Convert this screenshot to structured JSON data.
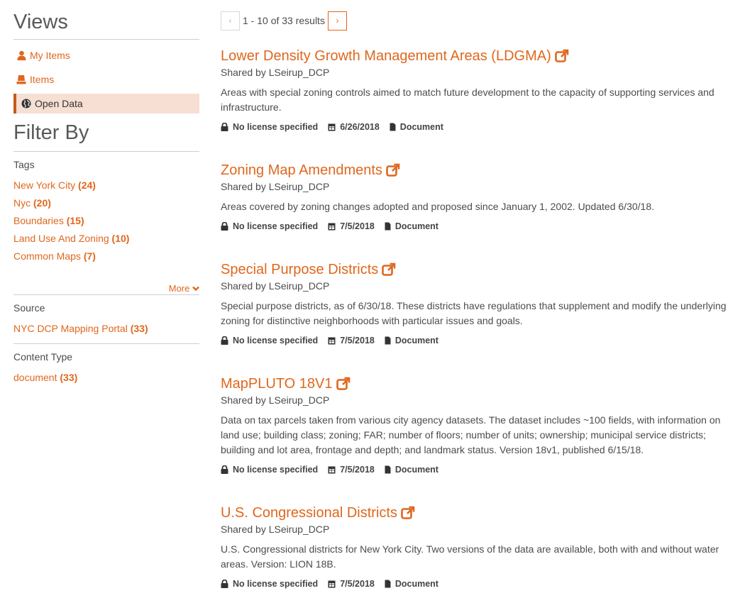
{
  "sidebar": {
    "views_title": "Views",
    "views": [
      {
        "label": "My Items",
        "icon": "user-icon"
      },
      {
        "label": "Items",
        "icon": "items-icon"
      },
      {
        "label": "Open Data",
        "icon": "globe-icon",
        "active": true
      }
    ],
    "filter_title": "Filter By",
    "tags": {
      "label": "Tags",
      "items": [
        {
          "name": "New York City",
          "count": "(24)"
        },
        {
          "name": "Nyc",
          "count": "(20)"
        },
        {
          "name": "Boundaries",
          "count": "(15)"
        },
        {
          "name": "Land Use And Zoning",
          "count": "(10)"
        },
        {
          "name": "Common Maps",
          "count": "(7)"
        }
      ],
      "more_label": "More"
    },
    "source": {
      "label": "Source",
      "items": [
        {
          "name": "NYC DCP Mapping Portal",
          "count": "(33)"
        }
      ]
    },
    "content_type": {
      "label": "Content Type",
      "items": [
        {
          "name": "document",
          "count": "(33)"
        }
      ]
    }
  },
  "pager": {
    "prev": "‹",
    "next": "›",
    "summary": "1 - 10 of 33 results"
  },
  "results": [
    {
      "title": "Lower Density Growth Management Areas (LDGMA)",
      "shared": "Shared by LSeirup_DCP",
      "description": "Areas with special zoning controls aimed to match future development to the capacity of supporting services and infrastructure.",
      "license": "No license specified",
      "date": "6/26/2018",
      "type": "Document"
    },
    {
      "title": "Zoning Map Amendments",
      "shared": "Shared by LSeirup_DCP",
      "description": "Areas covered by zoning changes adopted and proposed since January 1, 2002. Updated 6/30/18.",
      "license": "No license specified",
      "date": "7/5/2018",
      "type": "Document"
    },
    {
      "title": "Special Purpose Districts",
      "shared": "Shared by LSeirup_DCP",
      "description": "Special purpose districts, as of 6/30/18. These districts have regulations that supplement and modify the underlying zoning for distinctive neighborhoods with particular issues and goals.",
      "license": "No license specified",
      "date": "7/5/2018",
      "type": "Document"
    },
    {
      "title": "MapPLUTO 18V1",
      "shared": "Shared by LSeirup_DCP",
      "description": "Data on tax parcels taken from various city agency datasets. The dataset includes ~100 fields, with information on land use; building class; zoning; FAR; number of floors; number of units; ownership; municipal service districts; building and lot area, frontage and depth; and landmark status. Version 18v1, published 6/15/18.",
      "license": "No license specified",
      "date": "7/5/2018",
      "type": "Document"
    },
    {
      "title": "U.S. Congressional Districts",
      "shared": "Shared by LSeirup_DCP",
      "description": "U.S. Congressional districts for New York City. Two versions of the data are available, both with and without water areas. Version: LION 18B.",
      "license": "No license specified",
      "date": "7/5/2018",
      "type": "Document"
    }
  ]
}
